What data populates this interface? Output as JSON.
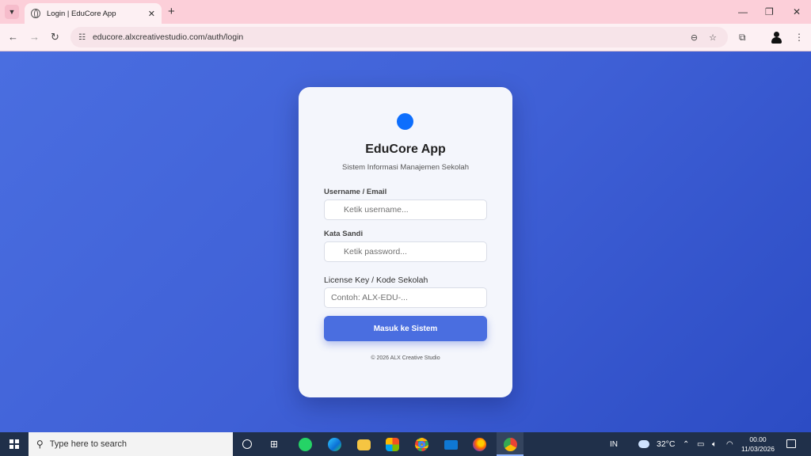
{
  "browser": {
    "tab_title": "Login | EduCore App",
    "url": "educore.alxcreativestudio.com/auth/login",
    "accent": "#fccfd9"
  },
  "login": {
    "app_title": "EduCore App",
    "app_subtitle": "Sistem Informasi Manajemen Sekolah",
    "username_label": "Username / Email",
    "username_placeholder": "Ketik username...",
    "password_label": "Kata Sandi",
    "password_placeholder": "Ketik password...",
    "license_label": "License Key / Kode Sekolah",
    "license_placeholder": "Contoh: ALX-EDU-...",
    "submit_label": "Masuk ke Sistem",
    "copyright": "© 2026 ALX Creative Studio",
    "brand_color": "#4a6ee0",
    "logo_color": "#0d6efd"
  },
  "taskbar": {
    "search_placeholder": "Type here to search",
    "language": "IN",
    "temperature": "32°C",
    "time": "00.00",
    "date": "11/03/2026",
    "apps": [
      "whatsapp-icon",
      "edge-icon",
      "file-explorer-icon",
      "store-icon",
      "chrome-icon",
      "mail-icon",
      "firefox-icon",
      "chrome-active-icon"
    ]
  }
}
